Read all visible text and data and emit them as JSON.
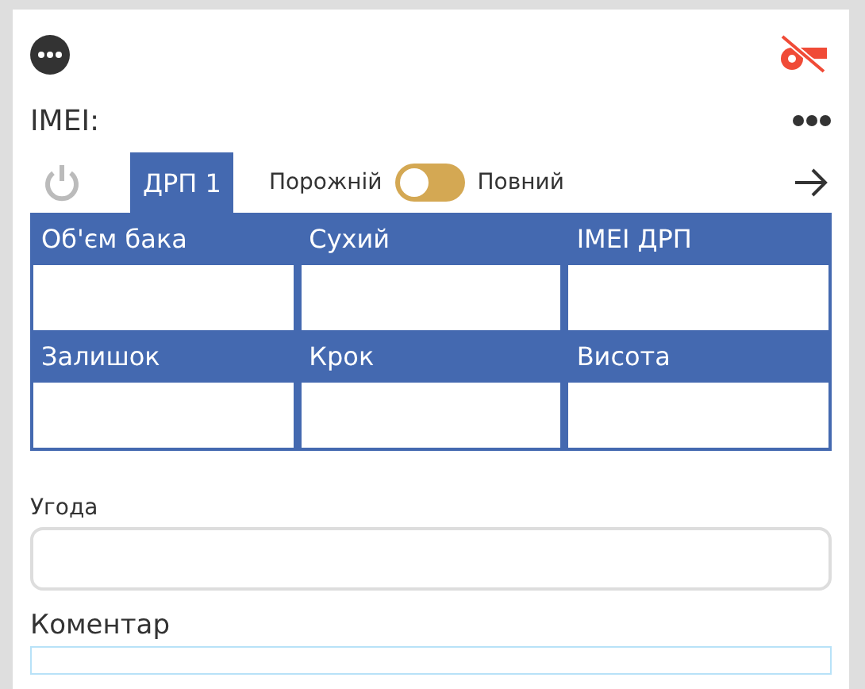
{
  "imei": {
    "label": "IMEI:"
  },
  "tabs": [
    {
      "label": "ДРП 1",
      "selected": true
    }
  ],
  "fill_toggle": {
    "left_label": "Порожній",
    "right_label": "Повний",
    "on": false
  },
  "grid": [
    {
      "label": "Об'єм бака"
    },
    {
      "label": "Сухий"
    },
    {
      "label": "IMEI ДРП"
    },
    {
      "label": "Залишок"
    },
    {
      "label": "Крок"
    },
    {
      "label": "Висота"
    }
  ],
  "agreement": {
    "label": "Угода"
  },
  "comment": {
    "label": "Коментар"
  }
}
